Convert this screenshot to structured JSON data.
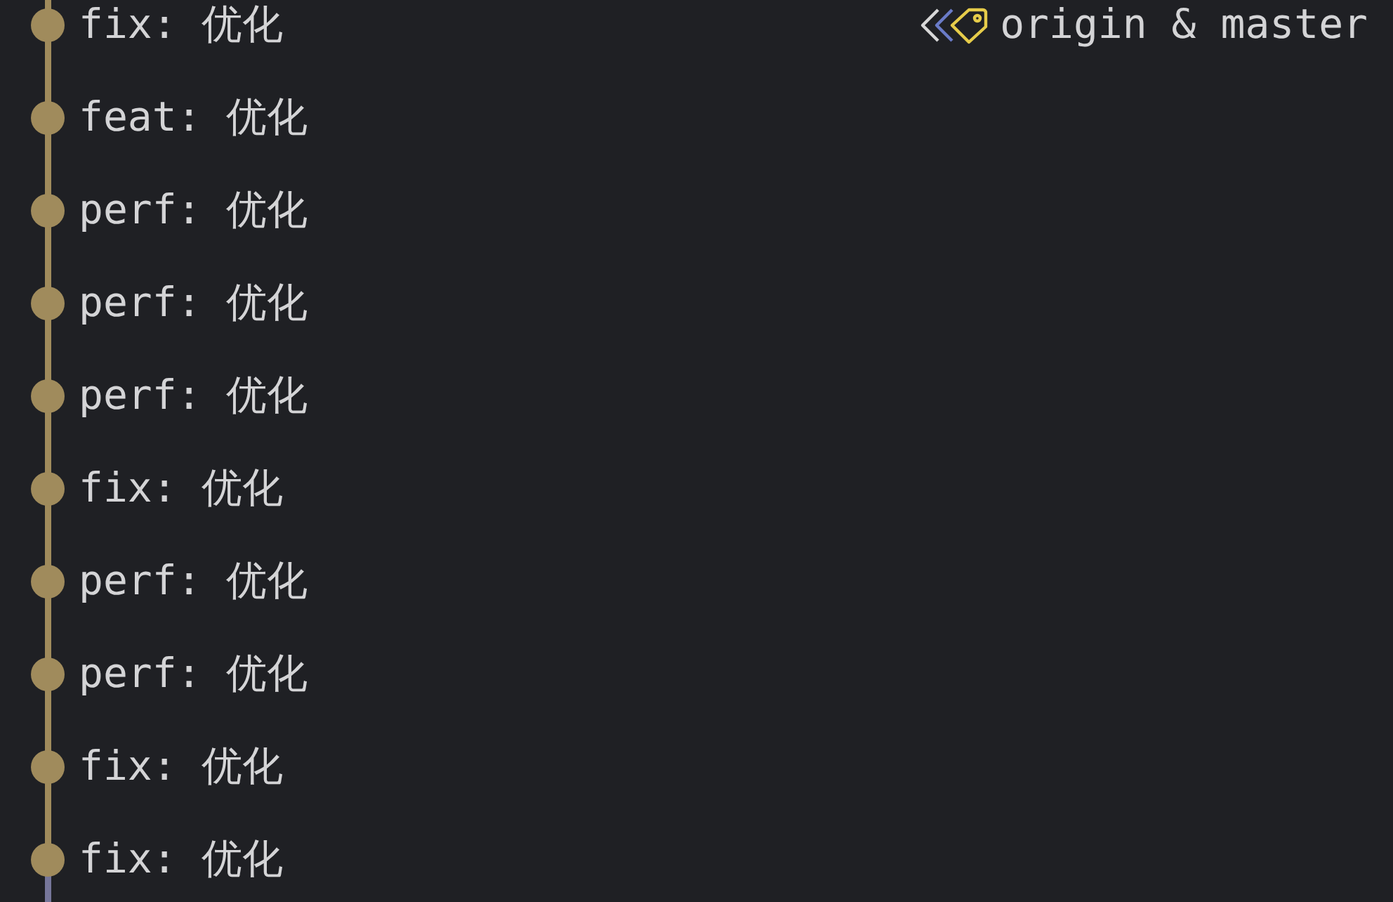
{
  "commits": [
    {
      "message": "fix: 优化",
      "refs": "origin & master"
    },
    {
      "message": "feat: 优化"
    },
    {
      "message": "perf: 优化"
    },
    {
      "message": "perf: 优化"
    },
    {
      "message": "perf: 优化"
    },
    {
      "message": "fix: 优化"
    },
    {
      "message": "perf: 优化"
    },
    {
      "message": "perf: 优化"
    },
    {
      "message": "fix: 优化"
    },
    {
      "message": "fix: 优化"
    }
  ]
}
